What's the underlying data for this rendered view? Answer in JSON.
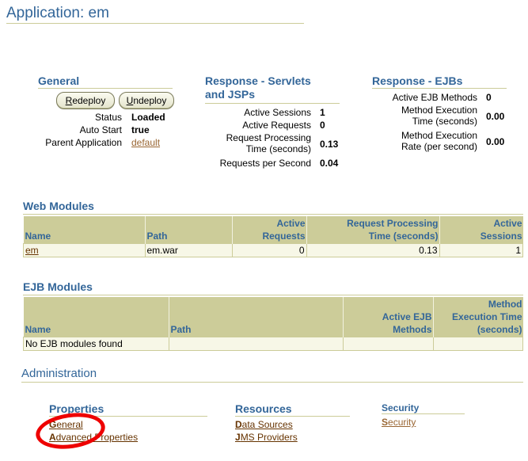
{
  "page": {
    "title": "Application: em"
  },
  "general": {
    "heading": "General",
    "buttons": [
      {
        "label_accel": "R",
        "label_rest": "edeploy"
      },
      {
        "label_accel": "U",
        "label_rest": "ndeploy"
      }
    ],
    "fields": [
      {
        "label": "Status",
        "value": "Loaded"
      },
      {
        "label": "Auto Start",
        "value": "true"
      },
      {
        "label": "Parent Application",
        "value": "default"
      }
    ]
  },
  "servlets": {
    "heading_line1": "Response - Servlets",
    "heading_line2": "and JSPs",
    "metrics": [
      {
        "label": "Active Sessions",
        "value": "1"
      },
      {
        "label": "Active Requests",
        "value": "0"
      },
      {
        "label_line1": "Request Processing",
        "label_line2": "Time (seconds)",
        "value": "0.13"
      },
      {
        "label": "Requests per Second",
        "value": "0.04"
      }
    ]
  },
  "ejbs": {
    "heading": "Response - EJBs",
    "metrics": [
      {
        "label": "Active EJB Methods",
        "value": "0"
      },
      {
        "label_line1": "Method Execution",
        "label_line2": "Time (seconds)",
        "value": "0.00"
      },
      {
        "label_line1": "Method Execution",
        "label_line2": "Rate (per second)",
        "value": "0.00"
      }
    ]
  },
  "web_modules": {
    "heading": "Web Modules",
    "columns": [
      {
        "line1": "",
        "line2": "Name"
      },
      {
        "line1": "",
        "line2": "Path"
      },
      {
        "line1": "Active",
        "line2": "Requests"
      },
      {
        "line1": "Request Processing",
        "line2": "Time (seconds)"
      },
      {
        "line1": "Active",
        "line2": "Sessions"
      }
    ],
    "rows": [
      {
        "name": "em",
        "path": "em.war",
        "active_requests": "0",
        "processing_time": "0.13",
        "active_sessions": "1"
      }
    ]
  },
  "ejb_modules": {
    "heading": "EJB Modules",
    "columns": [
      {
        "line1": "",
        "line2": "",
        "line3": "Name"
      },
      {
        "line1": "",
        "line2": "",
        "line3": "Path"
      },
      {
        "line1": "",
        "line2": "Active EJB",
        "line3": "Methods"
      },
      {
        "line1": "Method",
        "line2": "Execution Time",
        "line3": "(seconds)"
      }
    ],
    "empty_message": "No EJB modules found"
  },
  "administration": {
    "heading": "Administration",
    "properties": {
      "heading": "Properties",
      "links": [
        {
          "accel": "G",
          "rest": "eneral"
        },
        {
          "accel": "A",
          "rest": "dvanced Properties"
        }
      ]
    },
    "resources": {
      "heading": "Resources",
      "links": [
        {
          "accel": "D",
          "rest": "ata Sources"
        },
        {
          "accel": "J",
          "rest": "MS Providers"
        }
      ]
    },
    "security": {
      "heading": "Security",
      "links": [
        {
          "accel": "S",
          "rest": "ecurity"
        }
      ]
    }
  },
  "colors": {
    "heading": "#336699",
    "rule": "#cccc99",
    "link": "#663300",
    "highlight": "#ee0000"
  }
}
